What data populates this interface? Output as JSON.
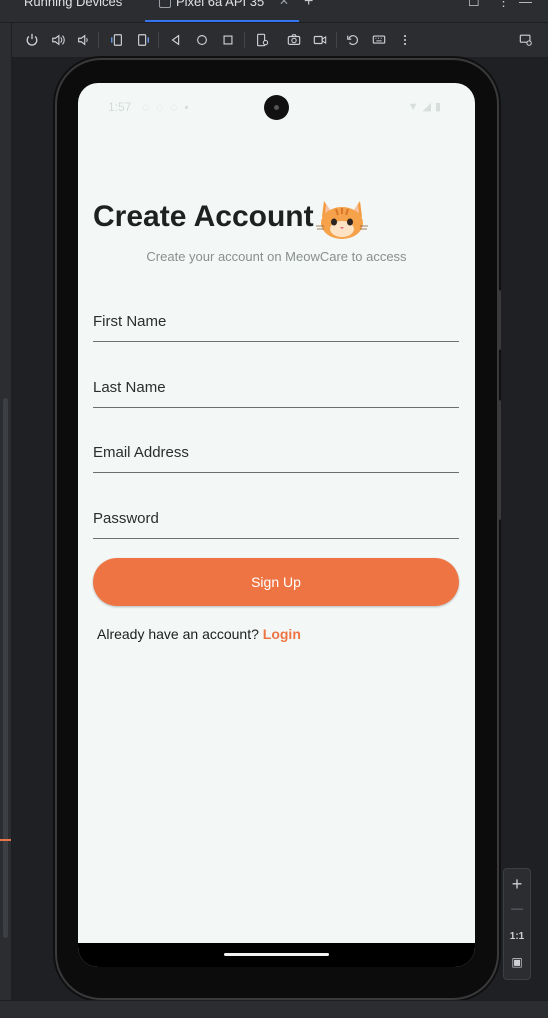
{
  "ide": {
    "panel_title": "Running Devices",
    "device_tab_label": "Pixel 6a API 35",
    "new_tab": "+",
    "toolbar_icons": [
      "power-icon",
      "volume-up-icon",
      "volume-down-icon",
      "rotate-left-icon",
      "rotate-right-icon",
      "back-icon",
      "home-icon",
      "overview-icon",
      "device-settings-icon",
      "screenshot-icon",
      "screen-record-icon",
      "reset-icon",
      "keyboard-icon",
      "more-icon",
      "display-icon"
    ],
    "zoom": {
      "in": "+",
      "out": "—",
      "actual": "1:1"
    },
    "accent_color": "#3574f0"
  },
  "phone": {
    "statusbar": {
      "time": "1:57"
    },
    "app": {
      "title": "Create Account",
      "subtitle": "Create your account on MeowCare to access",
      "fields": [
        {
          "placeholder": "First Name",
          "value": ""
        },
        {
          "placeholder": "Last Name",
          "value": ""
        },
        {
          "placeholder": "Email Address",
          "value": ""
        },
        {
          "placeholder": "Password",
          "value": ""
        }
      ],
      "signup_label": "Sign Up",
      "login_prompt": "Already have an account?",
      "login_link": "Login",
      "accent_color": "#ee7543",
      "background_color": "#f3f8f7"
    }
  }
}
